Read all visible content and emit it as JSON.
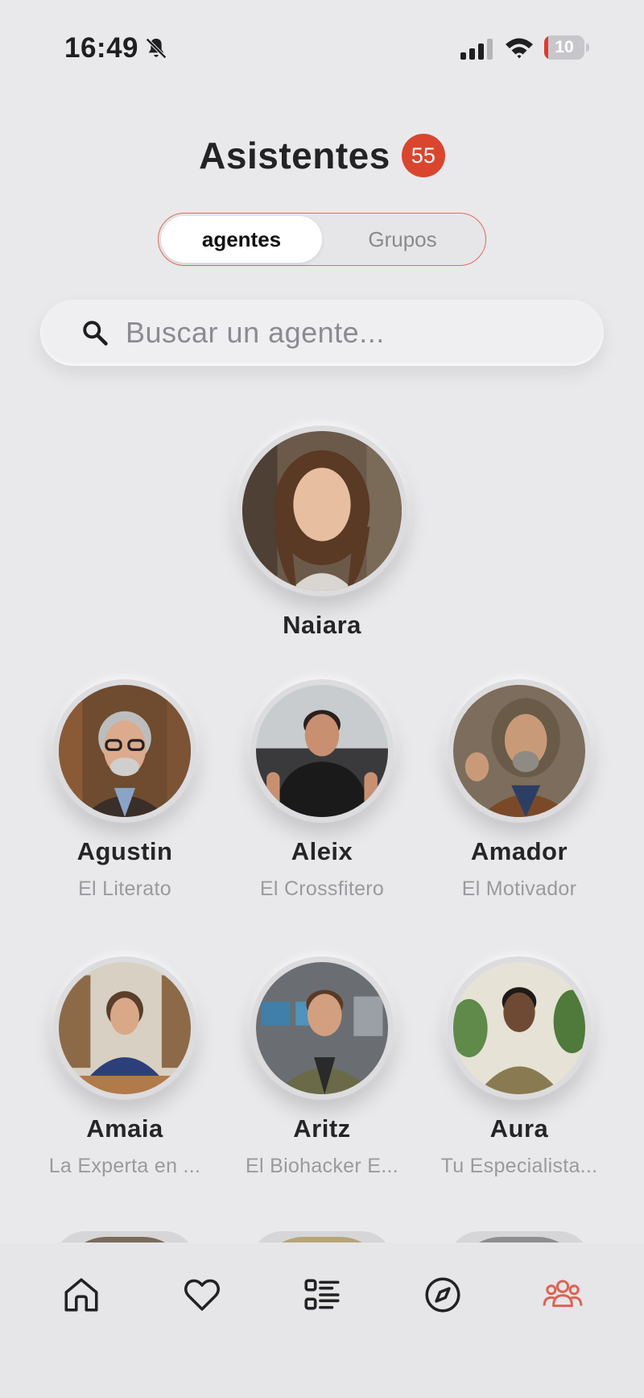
{
  "status_bar": {
    "time": "16:49",
    "battery": "10",
    "battery_level": 0.1
  },
  "header": {
    "title": "Asistentes",
    "count": "55"
  },
  "tabs": [
    {
      "label": "agentes",
      "active": true
    },
    {
      "label": "Grupos",
      "active": false
    }
  ],
  "search": {
    "placeholder": "Buscar un agente..."
  },
  "featured_agent": {
    "name": "Naiara"
  },
  "agents": [
    {
      "name": "Agustin",
      "role": "El Literato"
    },
    {
      "name": "Aleix",
      "role": "El Crossfitero"
    },
    {
      "name": "Amador",
      "role": "El Motivador"
    },
    {
      "name": "Amaia",
      "role": "La Experta en ..."
    },
    {
      "name": "Aritz",
      "role": "El Biohacker E..."
    },
    {
      "name": "Aura",
      "role": "Tu Especialista..."
    }
  ],
  "bottom_nav": [
    {
      "icon": "home-icon"
    },
    {
      "icon": "heart-icon"
    },
    {
      "icon": "list-icon"
    },
    {
      "icon": "compass-icon"
    },
    {
      "icon": "users-icon",
      "active": true
    }
  ],
  "colors": {
    "accent": "#d9452f",
    "active_nav": "#e0604f",
    "background": "#e9e9eb"
  }
}
